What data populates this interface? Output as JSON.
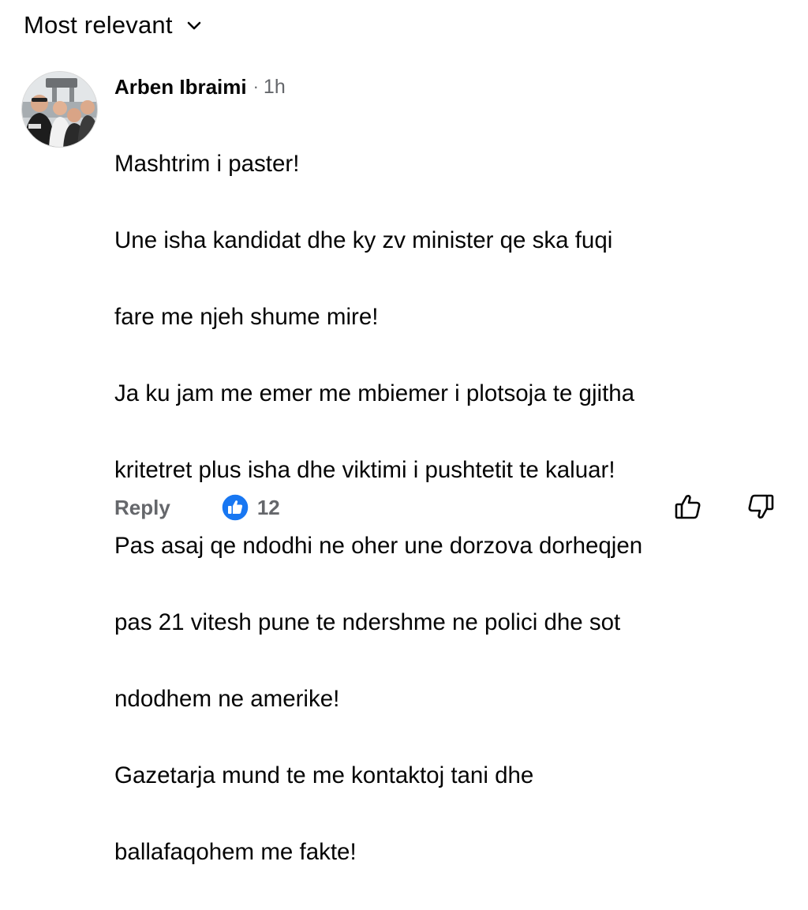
{
  "sort": {
    "label": "Most relevant",
    "chevron_icon": "chevron-down-icon"
  },
  "comment": {
    "author": "Arben Ibraimi",
    "separator": "·",
    "time": "1h",
    "lines": [
      "Mashtrim i paster!",
      "Une isha kandidat dhe ky zv minister qe ska fuqi",
      "fare me njeh shume mire!",
      "Ja ku jam me emer me mbiemer i plotsoja te gjitha",
      "kritetret plus isha dhe viktimi i pushtetit te kaluar!",
      "Pas asaj qe ndodhi ne oher une dorzova dorheqjen",
      "pas 21 vitesh pune te ndershme ne polici dhe sot",
      "ndodhem ne amerike!",
      "Gazetarja mund te me kontaktoj tani dhe",
      "ballafaqohem me fakte!"
    ],
    "reply_label": "Reply",
    "reaction_icon": "like-reaction-icon",
    "reaction_count": "12",
    "upvote_icon": "thumbs-up-outline-icon",
    "downvote_icon": "thumbs-down-outline-icon"
  },
  "colors": {
    "text_primary": "#050505",
    "text_secondary": "#65676b",
    "like_blue": "#1877f2"
  }
}
